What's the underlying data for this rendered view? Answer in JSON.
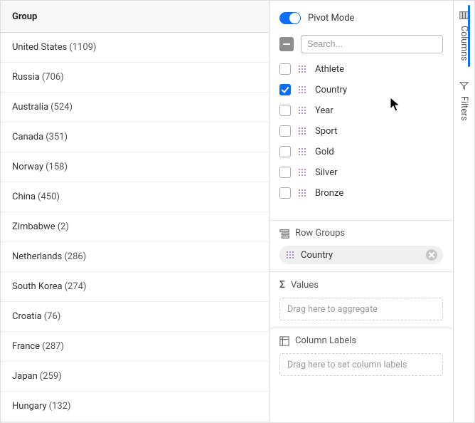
{
  "grid": {
    "header": "Group",
    "rows": [
      {
        "name": "United States",
        "count": "(1109)"
      },
      {
        "name": "Russia",
        "count": "(706)"
      },
      {
        "name": "Australia",
        "count": "(524)"
      },
      {
        "name": "Canada",
        "count": "(351)"
      },
      {
        "name": "Norway",
        "count": "(158)"
      },
      {
        "name": "China",
        "count": "(450)"
      },
      {
        "name": "Zimbabwe",
        "count": "(2)"
      },
      {
        "name": "Netherlands",
        "count": "(286)"
      },
      {
        "name": "South Korea",
        "count": "(274)"
      },
      {
        "name": "Croatia",
        "count": "(76)"
      },
      {
        "name": "France",
        "count": "(287)"
      },
      {
        "name": "Japan",
        "count": "(259)"
      },
      {
        "name": "Hungary",
        "count": "(132)"
      }
    ]
  },
  "toolPanel": {
    "pivotLabel": "Pivot Mode",
    "searchPlaceholder": "Search...",
    "columns": [
      {
        "label": "Athlete",
        "checked": false
      },
      {
        "label": "Country",
        "checked": true
      },
      {
        "label": "Year",
        "checked": false
      },
      {
        "label": "Sport",
        "checked": false
      },
      {
        "label": "Gold",
        "checked": false
      },
      {
        "label": "Silver",
        "checked": false
      },
      {
        "label": "Bronze",
        "checked": false
      }
    ],
    "rowGroups": {
      "title": "Row Groups",
      "chip": "Country"
    },
    "values": {
      "title": "Values",
      "placeholder": "Drag here to aggregate"
    },
    "columnLabels": {
      "title": "Column Labels",
      "placeholder": "Drag here to set column labels"
    }
  },
  "sideTabs": {
    "columns": "Columns",
    "filters": "Filters"
  }
}
